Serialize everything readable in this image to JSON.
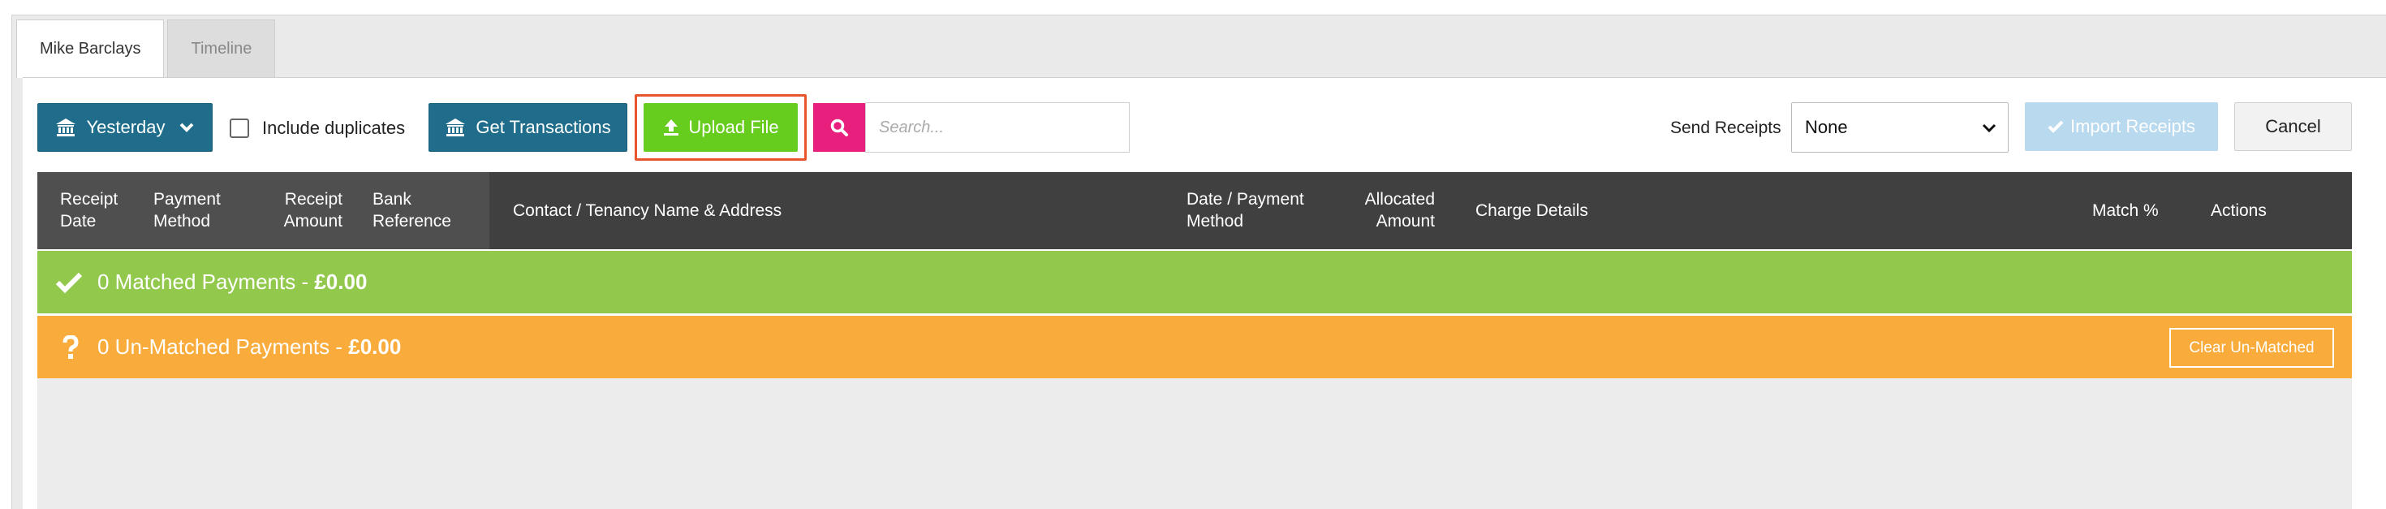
{
  "tabs": [
    {
      "label": "Mike Barclays",
      "active": true
    },
    {
      "label": "Timeline",
      "active": false
    }
  ],
  "toolbar": {
    "date_filter_label": "Yesterday",
    "include_duplicates_label": "Include duplicates",
    "get_transactions_label": "Get Transactions",
    "upload_file_label": "Upload File",
    "search_placeholder": "Search...",
    "send_receipts_label": "Send Receipts",
    "send_receipts_value": "None",
    "import_receipts_label": "Import Receipts",
    "cancel_label": "Cancel"
  },
  "table": {
    "columns": {
      "receipt_date": [
        "Receipt",
        "Date"
      ],
      "payment_method": [
        "Payment",
        "Method"
      ],
      "receipt_amount": [
        "Receipt",
        "Amount"
      ],
      "bank_reference": [
        "Bank",
        "Reference"
      ],
      "contact": "Contact / Tenancy Name & Address",
      "date_payment_method": [
        "Date / Payment",
        "Method"
      ],
      "allocated_amount": [
        "Allocated",
        "Amount"
      ],
      "charge_details": "Charge Details",
      "match": "Match %",
      "actions": "Actions"
    }
  },
  "matched": {
    "prefix": "0 Matched Payments - ",
    "amount": "£0.00"
  },
  "unmatched": {
    "prefix": "0 Un-Matched Payments - ",
    "amount": "£0.00",
    "clear_label": "Clear Un-Matched"
  },
  "colors": {
    "teal": "#1f6d8a",
    "green_button": "#66cc1e",
    "search_pink": "#e81f7c",
    "matched_green": "#92c94d",
    "unmatched_orange": "#f9ac3b",
    "header_dark": "#404040",
    "highlight_outline": "#e8552d"
  }
}
